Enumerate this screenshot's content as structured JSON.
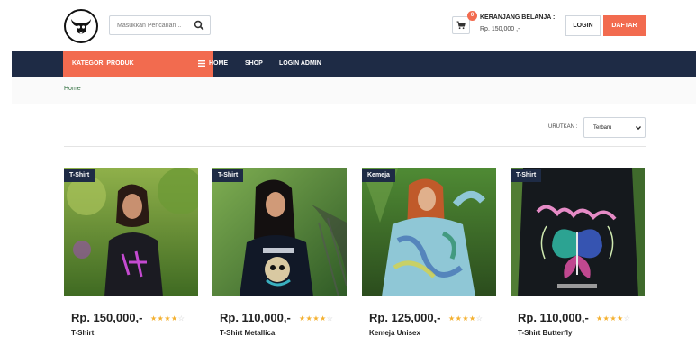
{
  "header": {
    "logo": "bull-skull-logo",
    "search": {
      "placeholder": "Masukkan Pencarian ..",
      "icon": "search-icon"
    },
    "cart": {
      "count": "0",
      "title": "KERANJANG BELANJA :",
      "total": "Rp. 150,000 ,-",
      "icon": "cart-icon"
    },
    "login_label": "LOGIN",
    "daftar_label": "DAFTAR"
  },
  "nav": {
    "kategori_label": "KATEGORI PRODUK",
    "links": [
      "HOME",
      "SHOP",
      "LOGIN ADMIN"
    ]
  },
  "breadcrumb": "Home",
  "sort": {
    "label": "URUTKAN :",
    "selected": "Terbaru"
  },
  "products": [
    {
      "tag": "T-Shirt",
      "price": "Rp. 150,000,-",
      "rating": 4,
      "max_rating": 5,
      "name": "T-Shirt"
    },
    {
      "tag": "T-Shirt",
      "price": "Rp. 110,000,-",
      "rating": 4,
      "max_rating": 5,
      "name": "T-Shirt Metallica"
    },
    {
      "tag": "Kemeja",
      "price": "Rp. 125,000,-",
      "rating": 4,
      "max_rating": 5,
      "name": "Kemeja Unisex"
    },
    {
      "tag": "T-Shirt",
      "price": "Rp. 110,000,-",
      "rating": 4,
      "max_rating": 5,
      "name": "T-Shirt Butterfly"
    }
  ],
  "colors": {
    "navy": "#1e2b45",
    "accent": "#f26b4f",
    "star": "#f4b02f"
  }
}
